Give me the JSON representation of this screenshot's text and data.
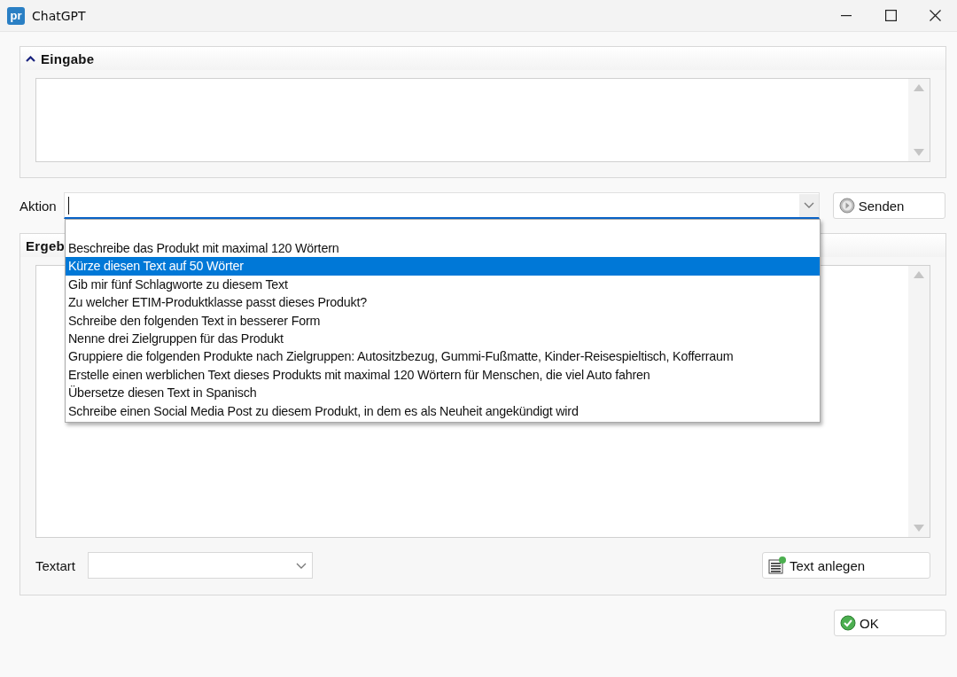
{
  "window": {
    "title": "ChatGPT",
    "logo": "pr"
  },
  "input_panel": {
    "title": "Eingabe",
    "expanded": true
  },
  "action": {
    "label": "Aktion",
    "send_button": "Senden",
    "dropdown_open": true,
    "options": [
      {
        "label": "Beschreibe das Produkt mit maximal 120 Wörtern",
        "selected": false
      },
      {
        "label": "Kürze diesen Text auf 50 Wörter",
        "selected": true
      },
      {
        "label": "Gib mir fünf Schlagworte zu diesem Text",
        "selected": false
      },
      {
        "label": "Zu welcher ETIM-Produktklasse passt dieses Produkt?",
        "selected": false
      },
      {
        "label": "Schreibe den folgenden Text in besserer Form",
        "selected": false
      },
      {
        "label": "Nenne drei Zielgruppen für das Produkt",
        "selected": false
      },
      {
        "label": "Gruppiere die folgenden Produkte nach Zielgruppen: Autositzbezug, Gummi-Fußmatte, Kinder-Reisespieltisch, Kofferraum",
        "selected": false
      },
      {
        "label": "Erstelle einen werblichen Text dieses Produkts mit maximal 120 Wörtern für Menschen, die viel Auto fahren",
        "selected": false
      },
      {
        "label": "Übersetze diesen Text in Spanisch",
        "selected": false
      },
      {
        "label": "Schreibe einen Social Media Post zu diesem Produkt, in dem es als Neuheit angekündigt wird",
        "selected": false
      }
    ]
  },
  "result_panel": {
    "title": "Ergeb",
    "textart_label": "Textart",
    "create_button": "Text anlegen"
  },
  "ok_button": "OK"
}
